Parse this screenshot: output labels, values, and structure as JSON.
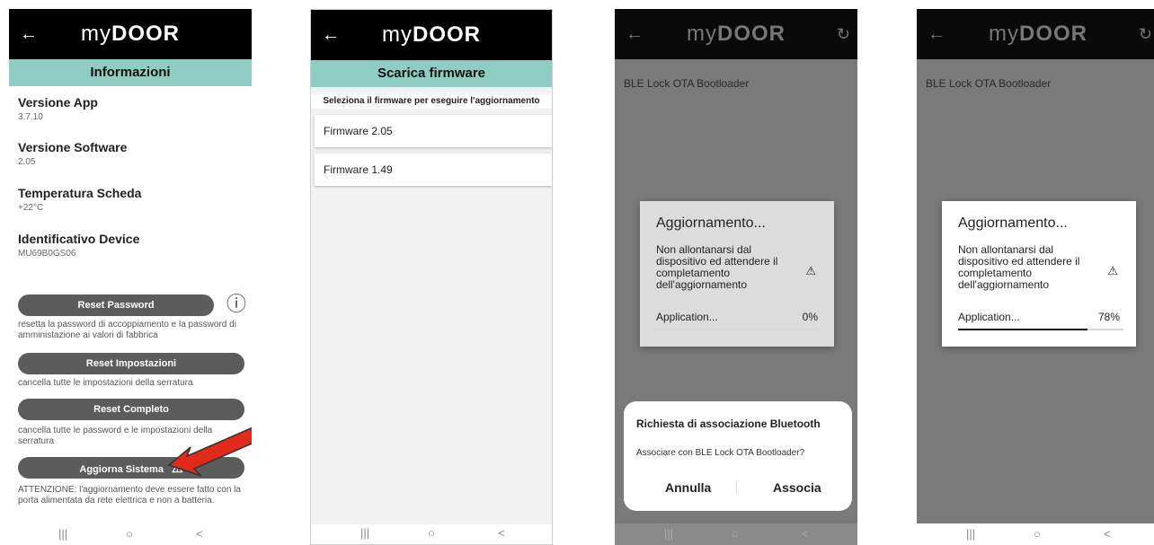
{
  "common": {
    "back": "←",
    "logo_my": "my",
    "logo_door": "DOOR",
    "refresh": "↻",
    "nav": {
      "recent": "|||",
      "home": "○",
      "back": "<"
    }
  },
  "screen1": {
    "title": "Informazioni",
    "items": [
      {
        "label": "Versione App",
        "value": "3.7.10"
      },
      {
        "label": "Versione Software",
        "value": "2.05"
      },
      {
        "label": "Temperatura Scheda",
        "value": "+22°C"
      },
      {
        "label": "Identificativo Device",
        "value": "MU69B0GS06"
      }
    ],
    "info_icon": "ⓘ",
    "buttons": [
      {
        "label": "Reset Password",
        "desc": "resetta la password di accoppiamento e la password di amministazione ai valori di fabbrica"
      },
      {
        "label": "Reset Impostazioni",
        "desc": "cancella tutte le impostazioni della serratura"
      },
      {
        "label": "Reset Completo",
        "desc": "cancella tutte le password e le impostazioni della serratura"
      },
      {
        "label": "Aggiorna Sistema",
        "desc": "ATTENZIONE: l'aggiornamento deve essere fatto con la porta alimentata da rete elettrica e non a batteria."
      }
    ],
    "warn": "⚠",
    "arrow_color": "#e02a1a"
  },
  "screen2": {
    "title": "Scarica firmware",
    "heading": "Seleziona il firmware per eseguire l'aggiornamento",
    "firmware": [
      "Firmware 2.05",
      "Firmware 1.49"
    ]
  },
  "screen3": {
    "device": "BLE Lock OTA Bootloader",
    "dialog": {
      "title": "Aggiornamento...",
      "message": "Non allontanarsi dal dispositivo ed attendere il completamento dell'aggiornamento",
      "warn": "⚠",
      "stage": "Application...",
      "percent": "0%",
      "progress": 0
    },
    "sheet": {
      "title": "Richiesta di associazione Bluetooth",
      "message": "Associare con BLE Lock OTA Bootloader?",
      "cancel": "Annulla",
      "confirm": "Associa"
    }
  },
  "screen4": {
    "device": "BLE Lock OTA Bootloader",
    "dialog": {
      "title": "Aggiornamento...",
      "message": "Non allontanarsi dal dispositivo ed attendere il completamento dell'aggiornamento",
      "warn": "⚠",
      "stage": "Application...",
      "percent": "78%",
      "progress": 0.78
    }
  }
}
